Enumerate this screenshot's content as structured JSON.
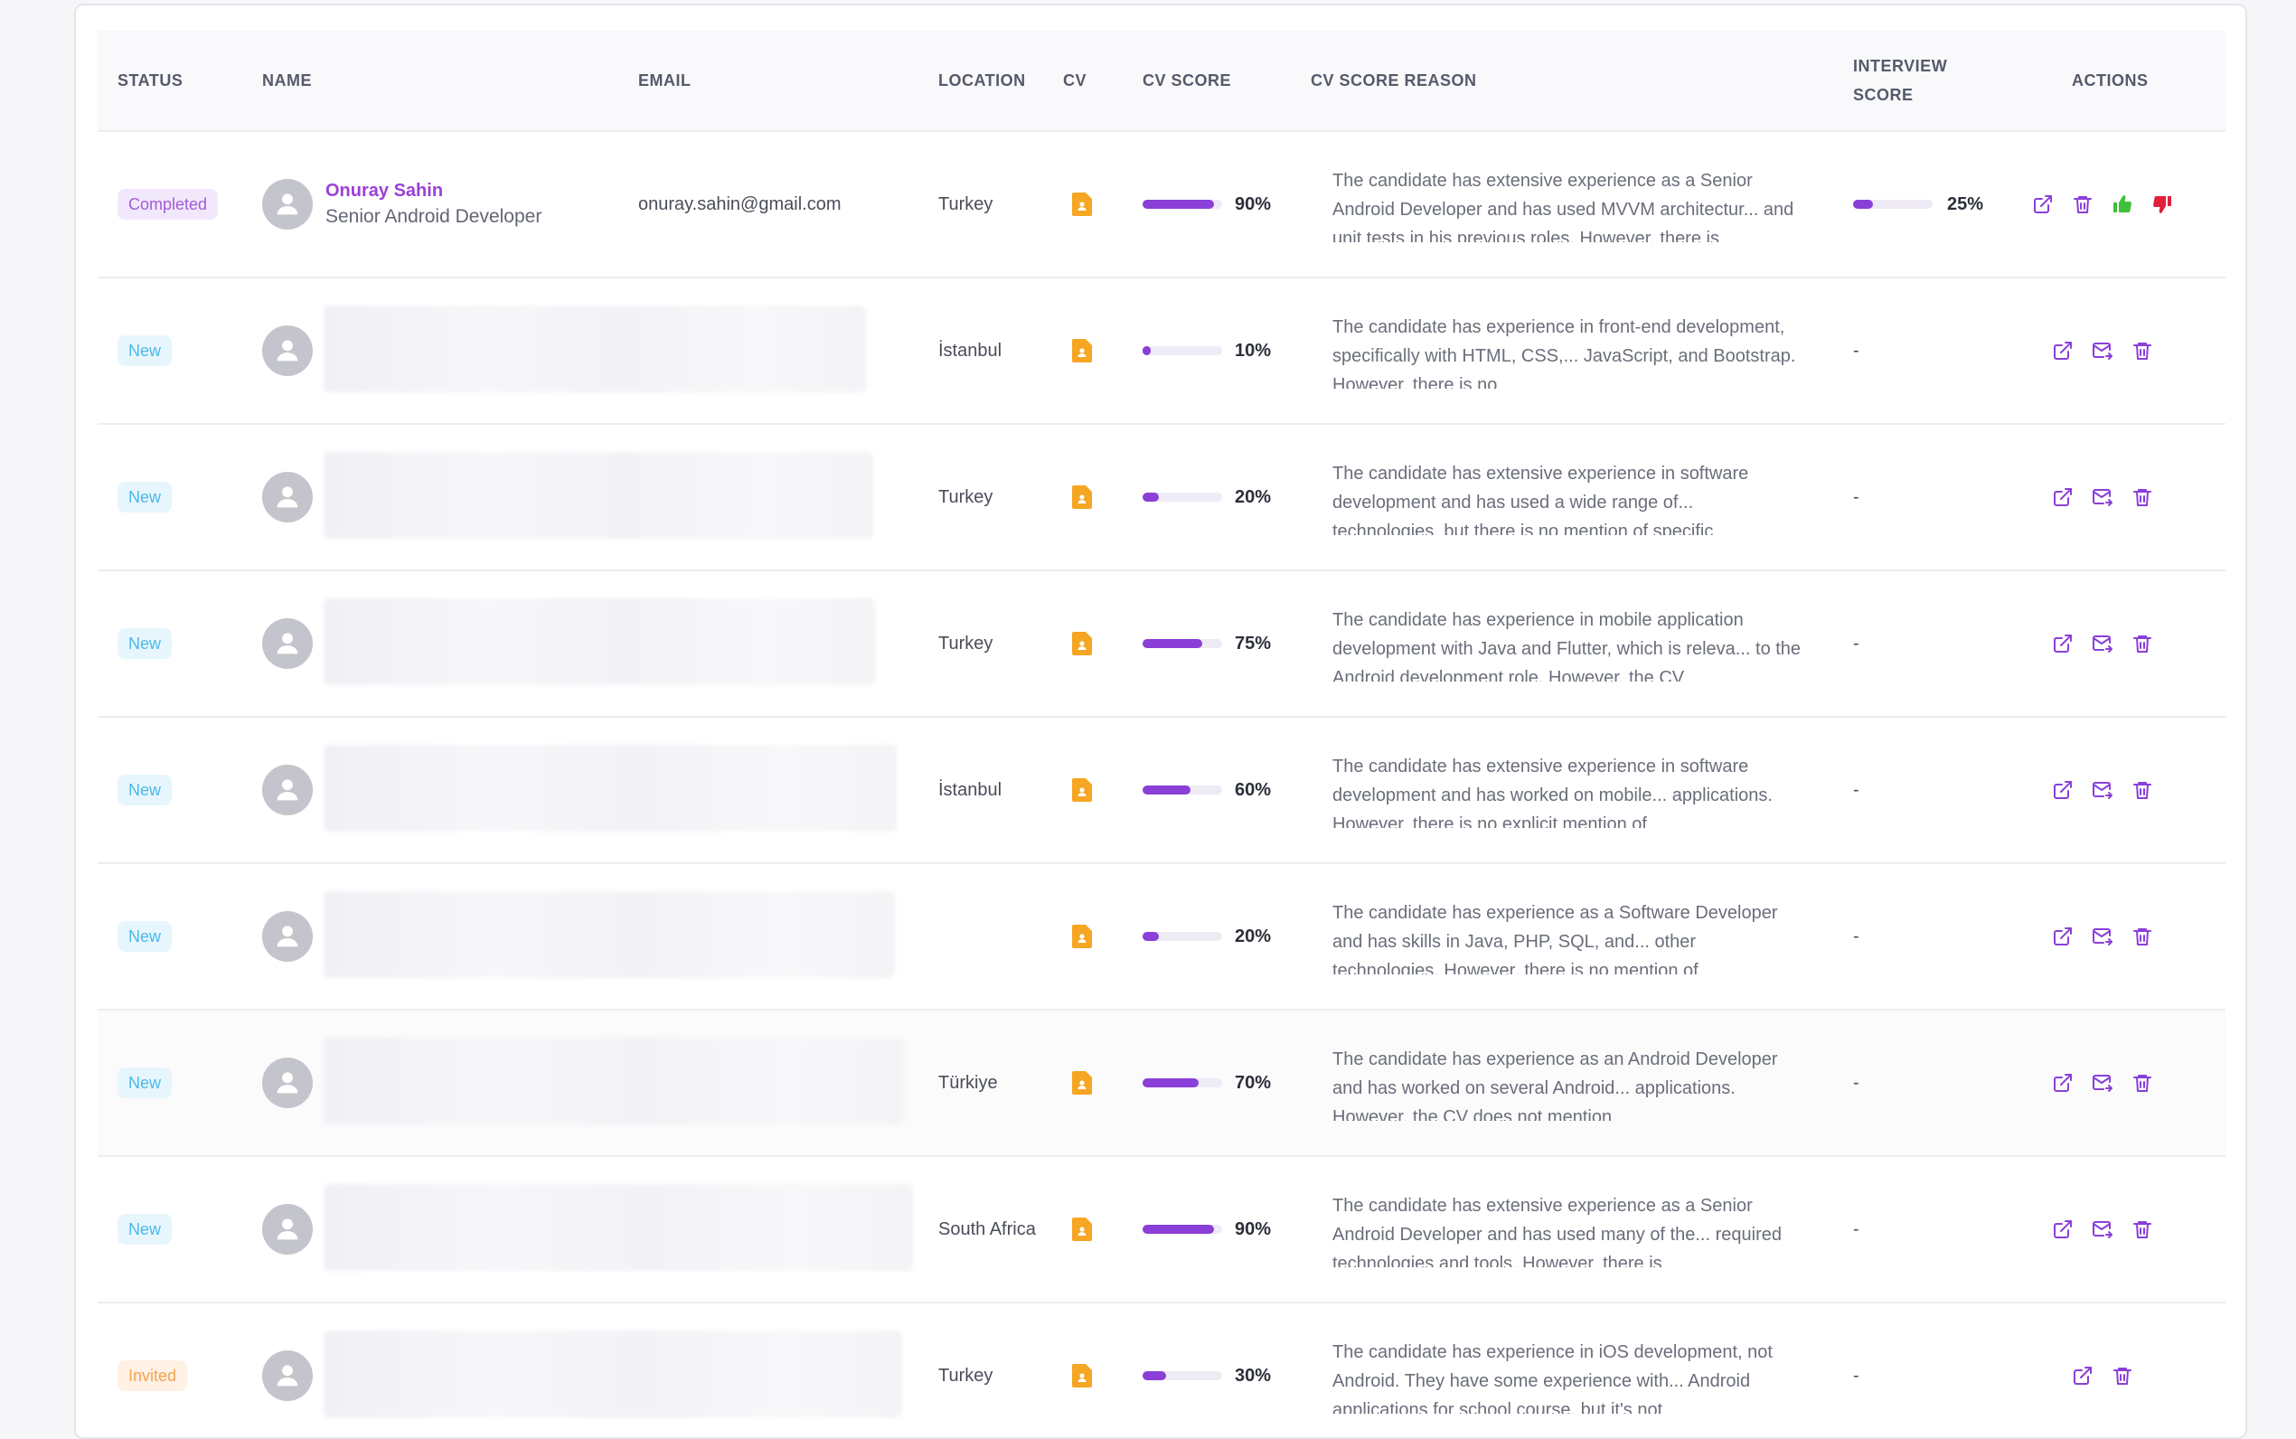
{
  "columns": {
    "status": "STATUS",
    "name": "NAME",
    "email": "EMAIL",
    "location": "LOCATION",
    "cv": "CV",
    "cv_score": "CV SCORE",
    "cv_score_reason": "CV SCORE REASON",
    "interview_score": "INTERVIEW SCORE",
    "actions": "ACTIONS"
  },
  "colors": {
    "accent": "#8a3fd8",
    "thumb_up": "#3fbf3a",
    "thumb_down": "#e0213c",
    "cv_icon": "#f5a623"
  },
  "rows": [
    {
      "status": "Completed",
      "status_type": "completed",
      "name": "Onuray Sahin",
      "title": "Senior Android Developer",
      "email": "onuray.sahin@gmail.com",
      "location": "Turkey",
      "cv_score": 0.9,
      "cv_score_label": "90%",
      "reason": "The candidate has extensive experience as a Senior Android Developer and has used MVVM architectur... and unit tests in his previous roles. However, there is",
      "interview_score": 0.25,
      "interview_score_label": "25%",
      "actions": [
        "open-icon",
        "trash-icon",
        "thumbs-up-icon",
        "thumbs-down-icon"
      ]
    },
    {
      "status": "New",
      "status_type": "new",
      "location": "İstanbul",
      "cv_score": 0.1,
      "cv_score_label": "10%",
      "reason": "The candidate has experience in front-end development, specifically with HTML, CSS,... JavaScript, and Bootstrap. However, there is no",
      "interview_score_label": "-",
      "actions": [
        "open-icon",
        "mail-forward-icon",
        "trash-icon"
      ]
    },
    {
      "status": "New",
      "status_type": "new",
      "location": "Turkey",
      "cv_score": 0.2,
      "cv_score_label": "20%",
      "reason": "The candidate has extensive experience in software development and has used a wide range of... technologies, but there is no mention of specific",
      "interview_score_label": "-",
      "actions": [
        "open-icon",
        "mail-forward-icon",
        "trash-icon"
      ]
    },
    {
      "status": "New",
      "status_type": "new",
      "location": "Turkey",
      "cv_score": 0.75,
      "cv_score_label": "75%",
      "reason": "The candidate has experience in mobile application development with Java and Flutter, which is releva... to the Android development role. However, the CV",
      "interview_score_label": "-",
      "actions": [
        "open-icon",
        "mail-forward-icon",
        "trash-icon"
      ]
    },
    {
      "status": "New",
      "status_type": "new",
      "location": "İstanbul",
      "cv_score": 0.6,
      "cv_score_label": "60%",
      "reason": "The candidate has extensive experience in software development and has worked on mobile... applications. However, there is no explicit mention of",
      "interview_score_label": "-",
      "actions": [
        "open-icon",
        "mail-forward-icon",
        "trash-icon"
      ]
    },
    {
      "status": "New",
      "status_type": "new",
      "location": "",
      "cv_score": 0.2,
      "cv_score_label": "20%",
      "reason": "The candidate has experience as a Software Developer and has skills in Java, PHP, SQL, and... other technologies. However, there is no mention of",
      "interview_score_label": "-",
      "actions": [
        "open-icon",
        "mail-forward-icon",
        "trash-icon"
      ]
    },
    {
      "status": "New",
      "status_type": "new",
      "location": "Türkiye",
      "cv_score": 0.7,
      "cv_score_label": "70%",
      "reason": "The candidate has experience as an Android Developer and has worked on several Android... applications. However, the CV does not mention",
      "interview_score_label": "-",
      "actions": [
        "open-icon",
        "mail-forward-icon",
        "trash-icon"
      ]
    },
    {
      "status": "New",
      "status_type": "new",
      "location": "South Africa",
      "cv_score": 0.9,
      "cv_score_label": "90%",
      "reason": "The candidate has extensive experience as a Senior Android Developer and has used many of the... required technologies and tools. However, there is",
      "interview_score_label": "-",
      "actions": [
        "open-icon",
        "mail-forward-icon",
        "trash-icon"
      ]
    },
    {
      "status": "Invited",
      "status_type": "invited",
      "location": "Turkey",
      "cv_score": 0.3,
      "cv_score_label": "30%",
      "reason": "The candidate has experience in iOS development, not Android. They have some experience with... Android applications for school course, but it's not",
      "interview_score_label": "-",
      "actions": [
        "open-icon",
        "trash-icon"
      ]
    }
  ]
}
